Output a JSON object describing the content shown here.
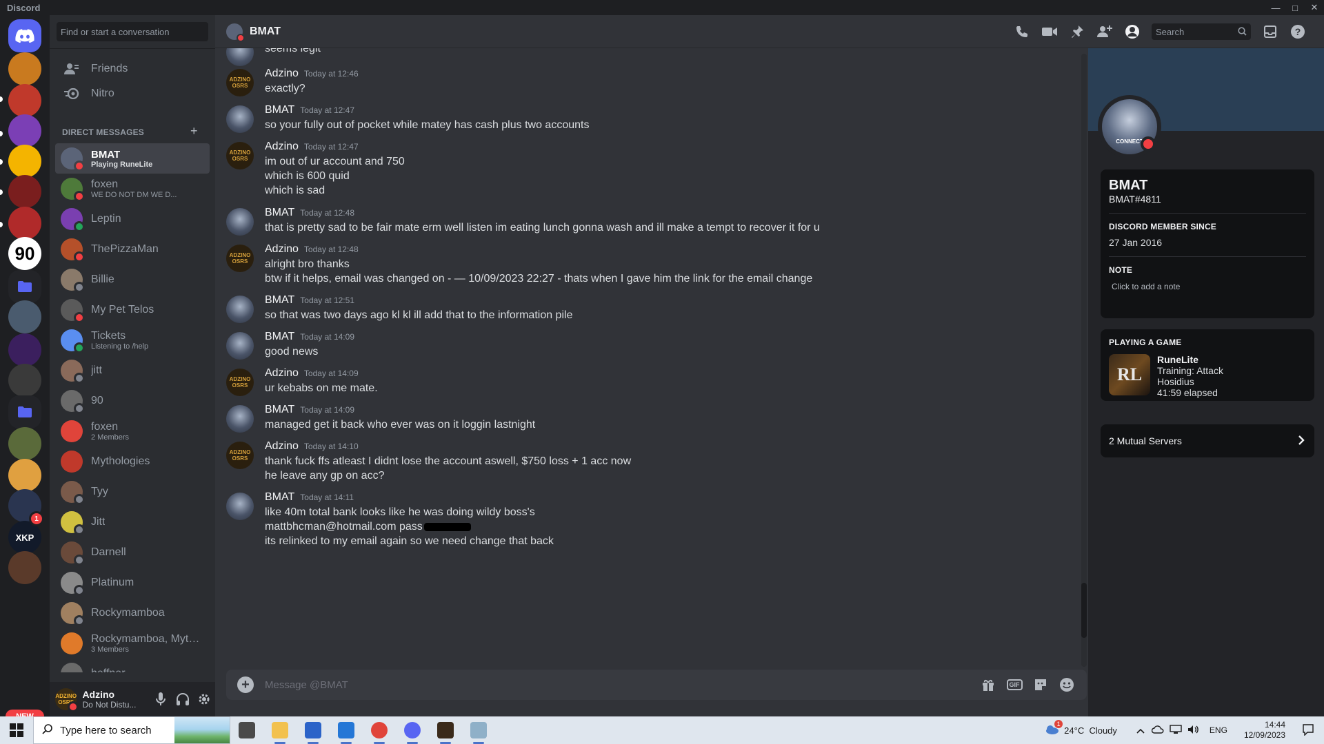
{
  "window": {
    "title": "Discord"
  },
  "rail": {
    "servers": [
      {
        "icon": "discord-home-icon",
        "color": "#5865f2",
        "label": ""
      },
      {
        "icon": "burger-server-icon",
        "color": "#c97a1f",
        "label": ""
      },
      {
        "icon": "badge-server-icon",
        "color": "#c0392b",
        "label": ""
      },
      {
        "icon": "purple-monster-server-icon",
        "color": "#7b3fb5",
        "label": ""
      },
      {
        "icon": "emoji-server-icon",
        "color": "#f4b400",
        "label": ""
      },
      {
        "icon": "spartan-server-icon",
        "color": "#7a1e1e",
        "label": ""
      },
      {
        "icon": "hat-server-icon",
        "color": "#b02a2a",
        "label": ""
      },
      {
        "icon": "ninety-server-icon",
        "color": "#ffffff",
        "label": "90"
      },
      {
        "icon": "folder-icon",
        "color": "#232428",
        "label": ""
      },
      {
        "icon": "figure-server-icon",
        "color": "#4a5b6e",
        "label": ""
      },
      {
        "icon": "purple-splash-server-icon",
        "color": "#3b1f5e",
        "label": ""
      },
      {
        "icon": "helmet-server-icon",
        "color": "#3a3a3a",
        "label": ""
      },
      {
        "icon": "folder-icon",
        "color": "#232428",
        "label": ""
      },
      {
        "icon": "crown-server-icon",
        "color": "#5a6a3a",
        "label": ""
      },
      {
        "icon": "duck-server-icon",
        "color": "#e0a040",
        "label": ""
      },
      {
        "icon": "dreamcatcher-server-icon",
        "color": "#2a3550",
        "label": ""
      },
      {
        "icon": "xkp-server-icon",
        "color": "#121a2a",
        "label": "XKP"
      },
      {
        "icon": "mystery-server-icon",
        "color": "#5a3a2a",
        "label": ""
      }
    ],
    "mention_badge": "1",
    "new_badge": "NEW"
  },
  "dm_sidebar": {
    "search_placeholder": "Find or start a conversation",
    "nav": [
      {
        "label": "Friends",
        "icon": "friends-icon"
      },
      {
        "label": "Nitro",
        "icon": "nitro-icon"
      }
    ],
    "section_title": "DIRECT MESSAGES",
    "items": [
      {
        "name": "BMAT",
        "sub": "Playing RuneLite",
        "status": "dnd",
        "color": "#5b6478",
        "active": true
      },
      {
        "name": "foxen",
        "sub": "WE DO NOT DM WE D...",
        "status": "dnd",
        "color": "#4e7a3a"
      },
      {
        "name": "Leptin",
        "sub": "",
        "status": "online",
        "color": "#7a3fb0"
      },
      {
        "name": "ThePizzaMan",
        "sub": "",
        "status": "dnd",
        "color": "#b5502a"
      },
      {
        "name": "Billie",
        "sub": "",
        "status": "offline",
        "color": "#8a7a6a"
      },
      {
        "name": "My Pet Telos",
        "sub": "",
        "status": "dnd",
        "color": "#5a5a5a"
      },
      {
        "name": "Tickets",
        "sub": "Listening to /help",
        "status": "online",
        "color": "#5a8ef0"
      },
      {
        "name": "jitt",
        "sub": "",
        "status": "offline",
        "color": "#8a6a5a"
      },
      {
        "name": "90",
        "sub": "",
        "status": "offline",
        "color": "#6a6a6a"
      },
      {
        "name": "foxen",
        "sub": "2 Members",
        "status": "",
        "color": "#e0443a"
      },
      {
        "name": "Mythologies",
        "sub": "",
        "status": "",
        "color": "#c0392b"
      },
      {
        "name": "Tyy",
        "sub": "",
        "status": "offline",
        "color": "#7a5a4a"
      },
      {
        "name": "Jitt",
        "sub": "",
        "status": "offline",
        "color": "#d0c040"
      },
      {
        "name": "Darnell",
        "sub": "",
        "status": "offline",
        "color": "#6a4a3a"
      },
      {
        "name": "Platinum",
        "sub": "",
        "status": "offline",
        "color": "#8a8a8a"
      },
      {
        "name": "Rockymamboa",
        "sub": "",
        "status": "offline",
        "color": "#a08060"
      },
      {
        "name": "Rockymamboa, Myth...",
        "sub": "3 Members",
        "status": "",
        "color": "#e07a2a"
      },
      {
        "name": "heffner",
        "sub": "",
        "status": "",
        "color": "#6a6a6a"
      }
    ]
  },
  "user_panel": {
    "name": "Adzino",
    "status": "Do Not Distu...",
    "avatar_text": "ADZINO OSRS"
  },
  "chat": {
    "title": "BMAT",
    "search_placeholder": "Search",
    "header_tools": [
      "voice-call-icon",
      "video-call-icon",
      "pin-icon",
      "add-friend-icon",
      "user-profile-icon"
    ],
    "messages": [
      {
        "author": "",
        "time": "",
        "lines": [
          "seems legit"
        ],
        "avatar": "bmat"
      },
      {
        "author": "Adzino",
        "time": "Today at 12:46",
        "lines": [
          "exactly?"
        ],
        "avatar": "adzino"
      },
      {
        "author": "BMAT",
        "time": "Today at 12:47",
        "lines": [
          "so your fully out of pocket while matey has cash plus two accounts"
        ],
        "avatar": "bmat"
      },
      {
        "author": "Adzino",
        "time": "Today at 12:47",
        "lines": [
          "im out of ur account and 750",
          "which is 600 quid",
          "which is sad"
        ],
        "avatar": "adzino"
      },
      {
        "author": "BMAT",
        "time": "Today at 12:48",
        "lines": [
          "that is pretty sad to be fair mate erm well listen im eating lunch gonna wash and ill make a tempt to recover it for u"
        ],
        "avatar": "bmat"
      },
      {
        "author": "Adzino",
        "time": "Today at 12:48",
        "lines": [
          "alright bro thanks",
          "btw if it helps, email was changed on -  — 10/09/2023 22:27 - thats when I gave him the link for the email change"
        ],
        "avatar": "adzino"
      },
      {
        "author": "BMAT",
        "time": "Today at 12:51",
        "lines": [
          "so that was two days ago kl kl ill add that to the information pile"
        ],
        "avatar": "bmat"
      },
      {
        "author": "BMAT",
        "time": "Today at 14:09",
        "lines": [
          "good news"
        ],
        "avatar": "bmat"
      },
      {
        "author": "Adzino",
        "time": "Today at 14:09",
        "lines": [
          "ur kebabs on me mate."
        ],
        "avatar": "adzino"
      },
      {
        "author": "BMAT",
        "time": "Today at 14:09",
        "lines": [
          "managed get it back who ever was on it loggin lastnight"
        ],
        "avatar": "bmat"
      },
      {
        "author": "Adzino",
        "time": "Today at 14:10",
        "lines": [
          "thank fuck ffs atleast I didnt lose the account aswell, $750 loss + 1 acc now",
          "he leave any gp on acc?"
        ],
        "avatar": "adzino"
      },
      {
        "author": "BMAT",
        "time": "Today at 14:11",
        "lines": [
          "like 40m total bank looks like he was doing wildy boss's",
          "mattbhcman@hotmail.com pass",
          "its relinked to my email again so we need change that back"
        ],
        "avatar": "bmat"
      }
    ],
    "composer_placeholder": "Message @BMAT",
    "composer_gif": "GIF"
  },
  "profile": {
    "name": "BMAT",
    "tag": "BMAT#4811",
    "avatar_caption": "CONNECT",
    "member_since_label": "DISCORD MEMBER SINCE",
    "member_since": "27 Jan 2016",
    "note_label": "NOTE",
    "note_placeholder": "Click to add a note",
    "activity_label": "PLAYING A GAME",
    "game": {
      "name": "RuneLite",
      "icon_text": "RL",
      "lines": [
        "Training: Attack",
        "Hosidius",
        "41:59 elapsed"
      ]
    },
    "mutual": "2 Mutual Servers"
  },
  "taskbar": {
    "search_placeholder": "Type here to search",
    "apps": [
      {
        "icon": "task-view-icon",
        "color": "#4a4a4a"
      },
      {
        "icon": "file-explorer-icon",
        "color": "#f2c14e"
      },
      {
        "icon": "store-icon",
        "color": "#2b63c8"
      },
      {
        "icon": "mail-icon",
        "color": "#2477d6"
      },
      {
        "icon": "chrome-icon",
        "color": "#e0443a"
      },
      {
        "icon": "discord-taskbar-icon",
        "color": "#5865f2"
      },
      {
        "icon": "runelite-icon",
        "color": "#3a2a1a"
      },
      {
        "icon": "app-icon",
        "color": "#8fb0c8"
      }
    ],
    "weather": "24°C  Cloudy",
    "weather_badge": "1",
    "lang": "ENG",
    "time": "14:44",
    "date": "12/09/2023"
  }
}
